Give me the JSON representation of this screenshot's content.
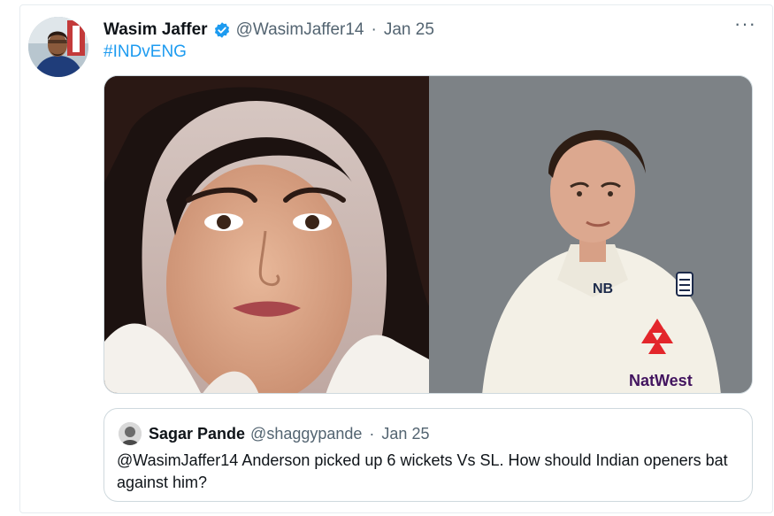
{
  "tweet": {
    "author_name": "Wasim Jaffer",
    "handle": "@WasimJaffer14",
    "separator": "·",
    "date": "Jan 25",
    "hashtag": "#INDvENG",
    "more_label": "···",
    "media": {
      "right_sponsor_text": "NatWest"
    }
  },
  "quoted": {
    "author_name": "Sagar Pande",
    "handle": "@shaggypande",
    "separator": "·",
    "date": "Jan 25",
    "text": "@WasimJaffer14  Anderson picked up 6 wickets Vs SL. How should Indian openers bat against him?"
  },
  "colors": {
    "link": "#1d9bf0",
    "secondary_text": "#536471",
    "border": "#cfd9de",
    "verified": "#1d9bf0",
    "natwest_red": "#e3262b",
    "natwest_purple": "#42145f"
  }
}
